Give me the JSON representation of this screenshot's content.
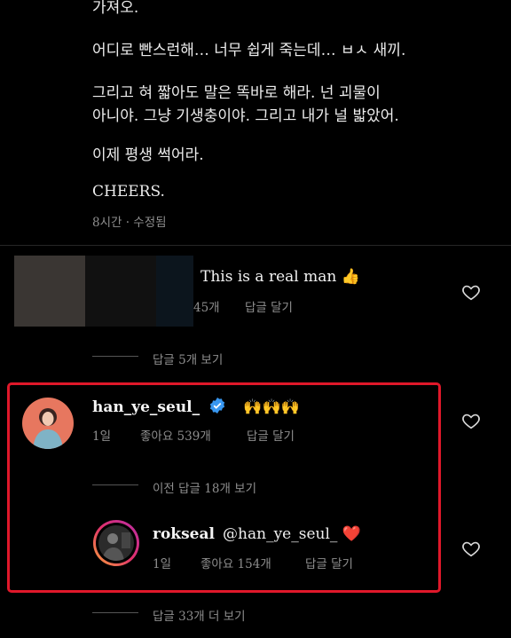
{
  "post": {
    "line0": "가져오.",
    "line1": "어디로 빤스런해… 너무 쉽게 죽는데… ㅂㅅ 새끼.",
    "line2": "그리고 혀 짧아도 말은 똑바로 해라. 넌 괴물이",
    "line3": "아니야. 그냥 기생충이야. 그리고 내가 널 밟았어.",
    "line4": "이제 평생 썩어라.",
    "line5": "CHEERS.",
    "meta": "8시간 · 수정됨"
  },
  "comment1": {
    "text": "This is a real man",
    "emoji": "👍",
    "likes": "45개",
    "reply": "답글 달기",
    "view_replies": "답글 5개 보기"
  },
  "comment2": {
    "username": "han_ye_seul_",
    "emoji": "🙌🙌🙌",
    "time": "1일",
    "likes": "좋아요 539개",
    "reply": "답글 달기",
    "prev_replies": "이전 답글 18개 보기"
  },
  "reply1": {
    "username": "rokseal",
    "mention": "@han_ye_seul_",
    "emoji": "❤️",
    "time": "1일",
    "likes": "좋아요 154개",
    "reply": "답글 달기"
  },
  "more_replies": "답글 33개 더 보기",
  "colors": {
    "highlight": "#e0182a",
    "verified": "#3897f0",
    "heart": "#e0283c"
  }
}
